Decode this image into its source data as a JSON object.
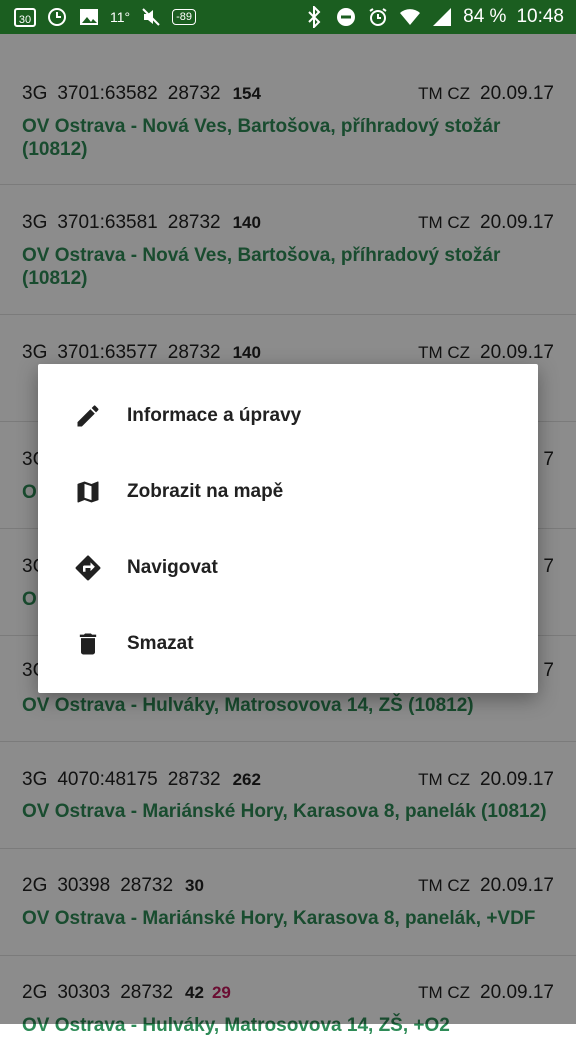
{
  "statusbar": {
    "left_date": "30",
    "temperature": "11°",
    "signal_badge": "-89",
    "battery": "84 %",
    "time": "10:48"
  },
  "list": {
    "rows": [
      {
        "tech": "3G",
        "cell": "3701:63582",
        "lac": "28732",
        "signal": "154",
        "operator": "TM CZ",
        "date": "20.09.17",
        "location": "OV Ostrava - Nová Ves, Bartošova, příhradový stožár (10812)"
      },
      {
        "tech": "3G",
        "cell": "3701:63581",
        "lac": "28732",
        "signal": "140",
        "operator": "TM CZ",
        "date": "20.09.17",
        "location": "OV Ostrava - Nová Ves, Bartošova, příhradový stožár (10812)"
      },
      {
        "tech": "3G",
        "cell": "3701:63577",
        "lac": "28732",
        "signal": "140",
        "operator": "TM CZ",
        "date": "20.09.17",
        "location": ""
      },
      {
        "tech": "3G",
        "cell": "",
        "lac": "",
        "signal": "",
        "operator": "",
        "date": "7",
        "location": "O"
      },
      {
        "tech": "3G",
        "cell": "",
        "lac": "",
        "signal": "",
        "operator": "",
        "date": "7",
        "location": "O"
      },
      {
        "tech": "3G",
        "cell": "",
        "lac": "",
        "signal": "",
        "operator": "",
        "date": "7",
        "location": "OV Ostrava - Hulváky, Matrosovova 14, ZŠ (10812)"
      },
      {
        "tech": "3G",
        "cell": "4070:48175",
        "lac": "28732",
        "signal": "262",
        "operator": "TM CZ",
        "date": "20.09.17",
        "location": "OV Ostrava - Mariánské Hory, Karasova 8, panelák (10812)"
      },
      {
        "tech": "2G",
        "cell": "30398",
        "lac": "28732",
        "signal": "30",
        "operator": "TM CZ",
        "date": "20.09.17",
        "location": "OV Ostrava - Mariánské Hory, Karasova 8, panelák, +VDF"
      },
      {
        "tech": "2G",
        "cell": "30303",
        "lac": "28732",
        "signal": "42",
        "signal2": "29",
        "operator": "TM CZ",
        "date": "20.09.17",
        "location": "OV Ostrava - Hulváky, Matrosovova 14, ZŠ, +O2"
      }
    ]
  },
  "dialog": {
    "items": [
      {
        "label": "Informace a úpravy",
        "icon": "pencil-icon"
      },
      {
        "label": "Zobrazit na mapě",
        "icon": "map-icon"
      },
      {
        "label": "Navigovat",
        "icon": "directions-icon"
      },
      {
        "label": "Smazat",
        "icon": "trash-icon"
      }
    ]
  },
  "colors": {
    "statusbar": "#1b5e20",
    "location_green": "#2e8b57",
    "signal_red": "#c2185b"
  }
}
